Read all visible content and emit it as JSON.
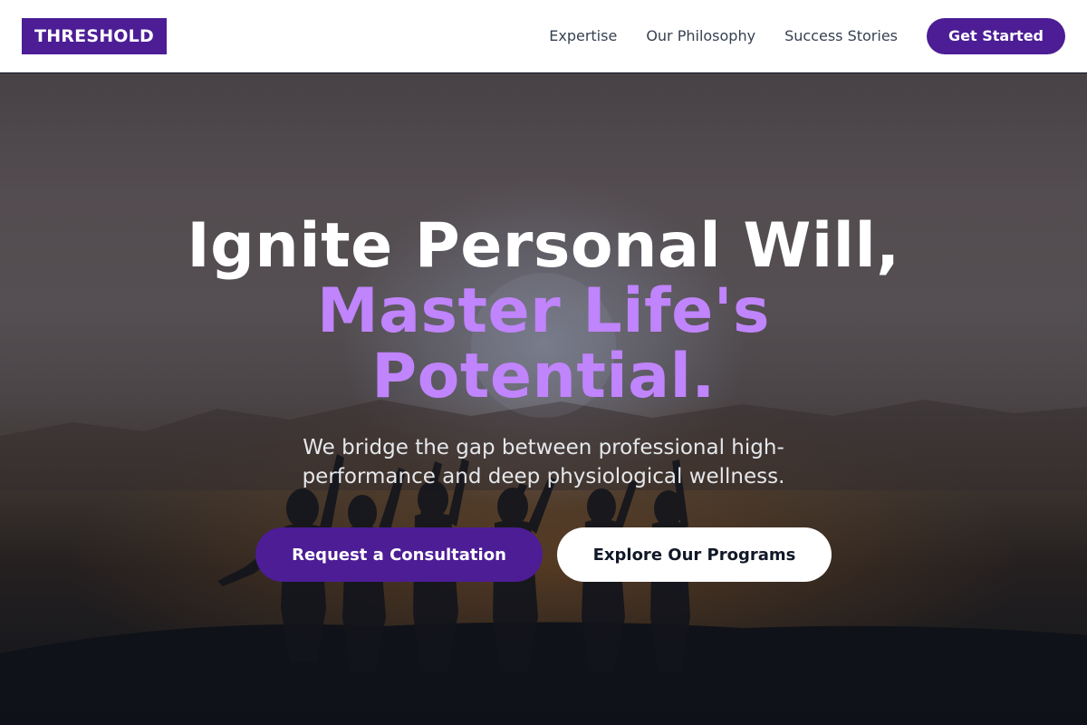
{
  "brand": {
    "logo_text": "THRESHOLD",
    "color": "#4c1d95"
  },
  "nav": {
    "links": [
      "Expertise",
      "Our Philosophy",
      "Success Stories"
    ],
    "cta_label": "Get Started"
  },
  "hero": {
    "headline_line1": "Ignite Personal Will,",
    "headline_accent": "Master Life's Potential.",
    "accent_color": "#c084fc",
    "subtitle": "We bridge the gap between professional high-performance and deep physiological wellness.",
    "primary_button": "Request a Consultation",
    "secondary_button": "Explore Our Programs",
    "background_image": "silhouettes-of-people-at-sunset"
  }
}
